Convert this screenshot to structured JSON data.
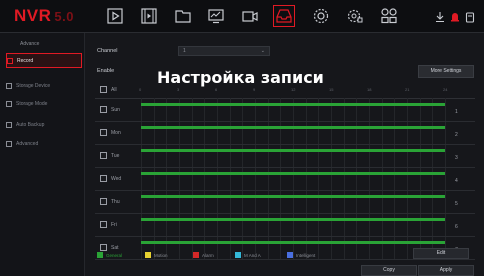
{
  "app": {
    "logo": "NVR",
    "version": "5.0"
  },
  "nav": {
    "icons": [
      "play-icon",
      "film-icon",
      "folder-icon",
      "monitor-chart-icon",
      "camera-icon",
      "inbox-icon",
      "gear-icon",
      "network-gear-icon",
      "grid-icon"
    ],
    "active_index": 5
  },
  "topright": [
    "download-icon",
    "alert-icon",
    "delete-icon"
  ],
  "sidebar": {
    "heading": "Advance",
    "items": [
      {
        "label": "Record",
        "active": true
      },
      {
        "label": "Storage Device",
        "active": false
      },
      {
        "label": "Storage Mode",
        "active": false
      },
      {
        "label": "Auto Backup",
        "active": false
      },
      {
        "label": "Advanced",
        "active": false
      }
    ]
  },
  "main": {
    "channel_label": "Channel",
    "channel_value": "1",
    "enable_label": "Enable",
    "overlay_title": "Настройка записи",
    "more_settings": "More Settings",
    "all_label": "All",
    "hours": [
      "0",
      "3",
      "6",
      "9",
      "12",
      "15",
      "18",
      "21",
      "24"
    ],
    "days": [
      {
        "label": "Sun",
        "num": "1"
      },
      {
        "label": "Mon",
        "num": "2"
      },
      {
        "label": "Tue",
        "num": "3"
      },
      {
        "label": "Wed",
        "num": "4"
      },
      {
        "label": "Thu",
        "num": "5"
      },
      {
        "label": "Fri",
        "num": "6"
      },
      {
        "label": "Sat",
        "num": "7"
      }
    ],
    "legend": [
      {
        "label": "General",
        "color": "#2aa336"
      },
      {
        "label": "Motion",
        "color": "#e8d232"
      },
      {
        "label": "Alarm",
        "color": "#d42828"
      },
      {
        "label": "M And A",
        "color": "#34b8d8"
      },
      {
        "label": "Intelligent",
        "color": "#4a6fe0"
      }
    ],
    "edit_label": "Edit",
    "copy_label": "Copy",
    "apply_label": "Apply"
  },
  "colors": {
    "accent": "#e01a24",
    "schedule": "#2aa336"
  }
}
